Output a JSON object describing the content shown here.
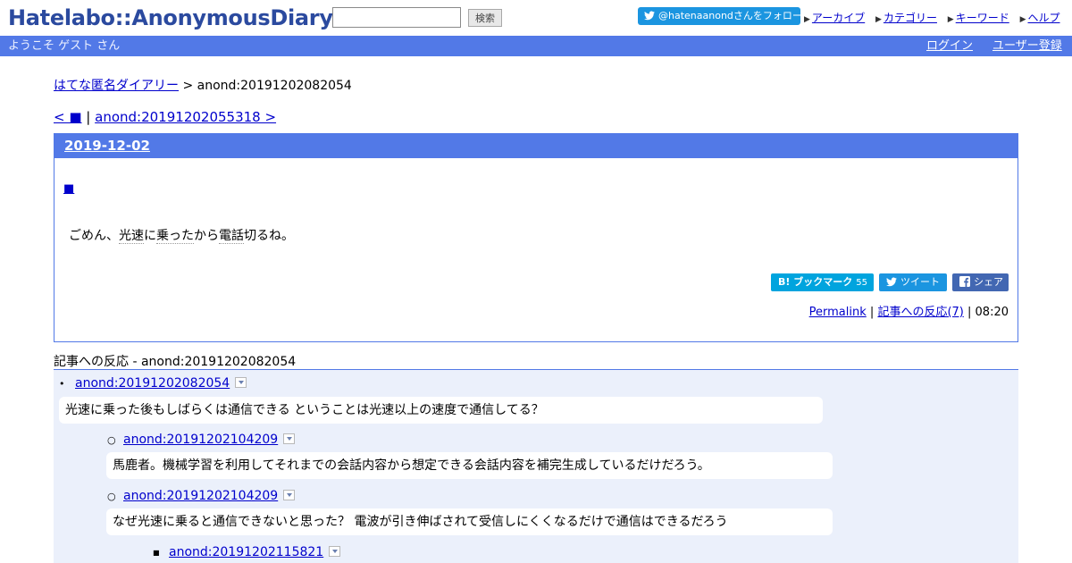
{
  "header": {
    "logo": "Hatelabo::AnonymousDiary",
    "search_value": "",
    "search_button": "検索",
    "follow_label": "@hatenaanondさんをフォロー",
    "links": [
      "アーカイブ",
      "カテゴリー",
      "キーワード",
      "ヘルプ"
    ]
  },
  "userbar": {
    "welcome": "ようこそ ゲスト さん",
    "login": "ログイン",
    "signup": "ユーザー登録"
  },
  "breadcrumb": {
    "root": "はてな匿名ダイアリー",
    "separator": ">",
    "current": "anond:20191202082054"
  },
  "pager": {
    "prev": "< ■",
    "separator": "|",
    "next": "anond:20191202055318 >"
  },
  "day": {
    "date": "2019-12-02",
    "entry_title": "■",
    "body_parts": [
      "ごめん、",
      "光速",
      "に",
      "乗った",
      "から",
      "電話",
      "切るね。"
    ]
  },
  "share": {
    "bookmark_label": "B! ブックマーク",
    "bookmark_count": "55",
    "tweet_label": "ツイート",
    "facebook_label": "シェア"
  },
  "meta": {
    "permalink": "Permalink",
    "separator": "|",
    "reactions": "記事への反応(7)",
    "time": "08:20"
  },
  "references": {
    "title": "記事への反応 - anond:20191202082054",
    "items": [
      {
        "id": "anond:20191202082054",
        "bullet": "•",
        "text": "光速に乗った後もしばらくは通信できる ということは光速以上の速度で通信してる？"
      },
      {
        "id": "anond:20191202104209",
        "bullet": "○",
        "text": "馬鹿者。機械学習を利用してそれまでの会話内容から想定できる会話内容を補完生成しているだけだろう。"
      },
      {
        "id": "anond:20191202104209",
        "bullet": "○",
        "text": "なぜ光速に乗ると通信できないと思った？ 電波が引き伸ばされて受信しにくくなるだけで通信はできるだろう"
      },
      {
        "id": "anond:20191202115821",
        "bullet": "■",
        "text": ""
      }
    ]
  },
  "colors": {
    "brand_blue": "#5279e7",
    "logo_blue": "#2b4a9f",
    "link": "#0000cc",
    "twitter": "#1b95e0",
    "hatena": "#00a4de",
    "facebook": "#4267b2",
    "reference_bg": "#ebf0fb"
  }
}
